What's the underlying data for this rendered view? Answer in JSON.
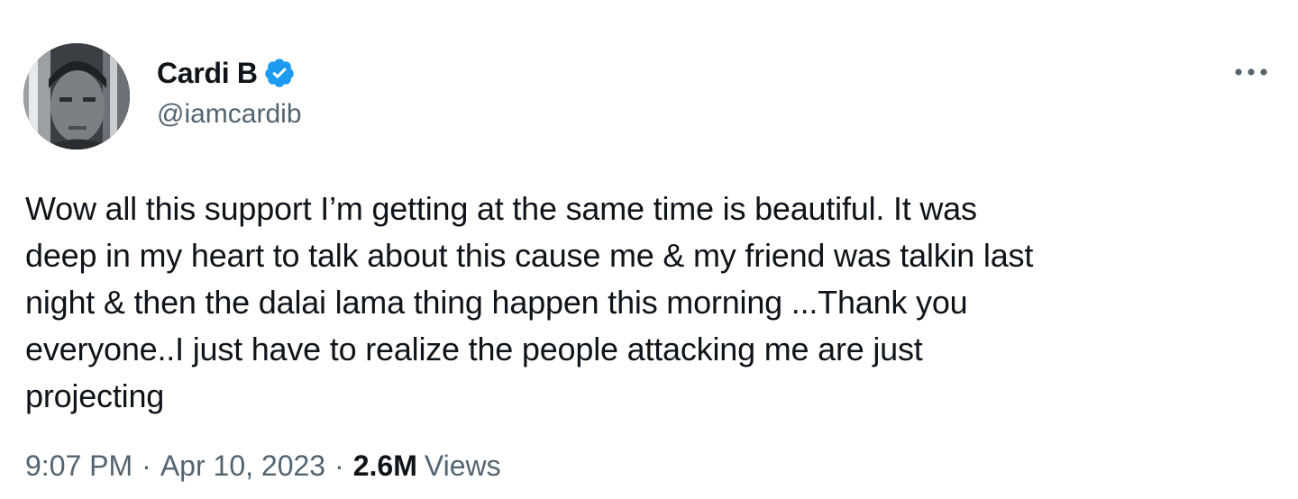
{
  "tweet": {
    "author": {
      "display_name": "Cardi B",
      "handle": "@iamcardib",
      "verified": true,
      "verified_color": "#1d9bf0",
      "avatar_icon": "profile-photo"
    },
    "more_icon": "more-horizontal-icon",
    "text_lines": [
      "Wow all this support I’m getting at the same time is beautiful. It was",
      "deep in my heart to talk about this cause me & my friend was talkin last",
      "night & then the dalai lama thing happen this morning ...Thank you",
      "everyone..I just have to realize the people attacking me are just",
      "projecting"
    ],
    "meta": {
      "time": "9:07 PM",
      "separator": "·",
      "date": "Apr 10, 2023",
      "views_count": "2.6M",
      "views_label": "Views"
    }
  },
  "colors": {
    "text_primary": "#0f1419",
    "text_secondary": "#536471",
    "accent": "#1d9bf0",
    "background": "#ffffff"
  }
}
